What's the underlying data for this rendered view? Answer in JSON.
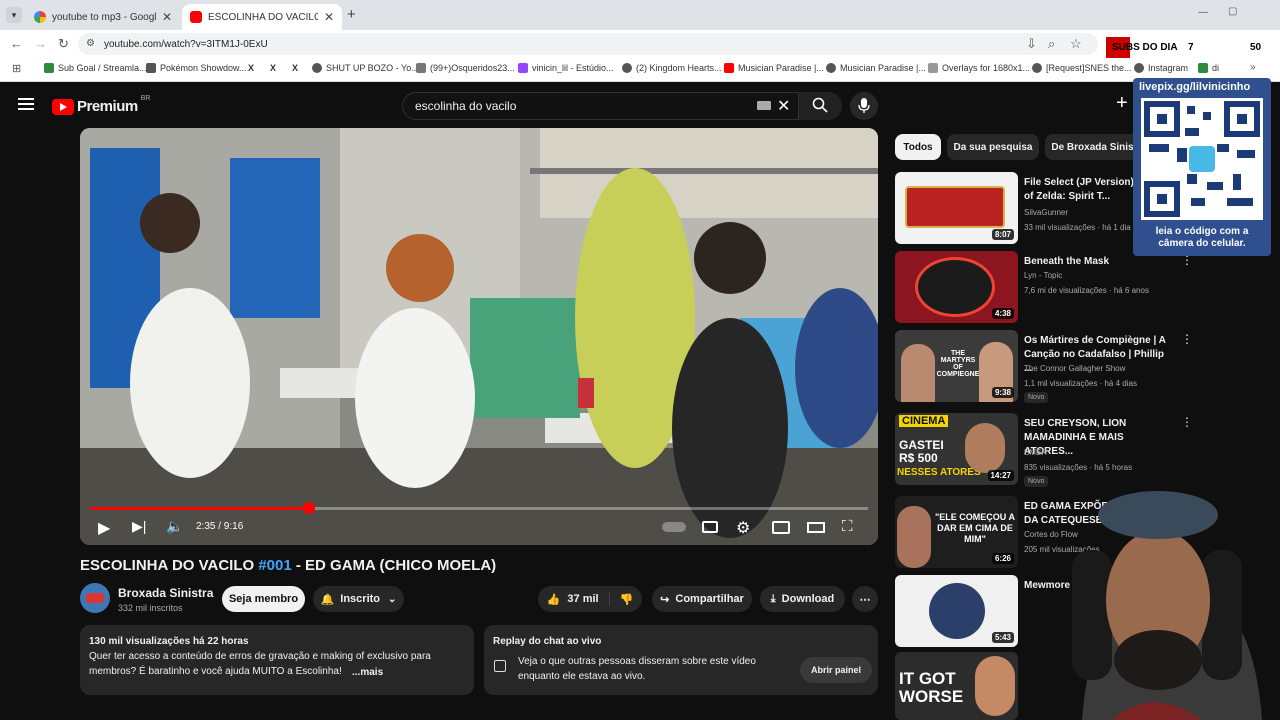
{
  "browser": {
    "tabs": [
      {
        "label": "youtube to mp3 - Google Sear",
        "active": false,
        "icon": "google-icon"
      },
      {
        "label": "ESCOLINHA DO VACILO #001 -",
        "active": true,
        "icon": "youtube-icon"
      }
    ],
    "url": "youtube.com/watch?v=3ITM1J-0ExU",
    "bookmarks": [
      "Sub Goal / Streamla...",
      "Pokémon Showdow...",
      "X",
      "X",
      "SHUT UP BOZO - Yo...",
      "(99+)Osqueridos23...",
      "vinicin_lil - Estúdio...",
      "(2) Kingdom Hearts...",
      "Musician Paradise |...",
      "Musician Paradise |...",
      "Overlays for 1680x1...",
      "[Request]SNES the...",
      "Instagram",
      "di"
    ]
  },
  "overlay": {
    "subs_label": "SUBS DO DIA",
    "subs_count": "7",
    "subs_goal": "50",
    "qr_url": "livepix.gg/lilvinicinho",
    "qr_caption": "leia o código com a câmera do celular."
  },
  "header": {
    "logo": "Premium",
    "region": "BR",
    "search_value": "escolinha do vacilo"
  },
  "player": {
    "time": "2:35 / 9:16",
    "progress": 0.282
  },
  "video": {
    "title_prefix": "ESCOLINHA DO VACILO ",
    "title_hash": "#001",
    "title_suffix": " - ED GAMA (CHICO MOELA)",
    "channel": "Broxada Sinistra",
    "subscribers": "332 mil inscritos",
    "join_label": "Seja membro",
    "subscribed_label": "Inscrito",
    "likes": "37 mil",
    "share_label": "Compartilhar",
    "download_label": "Download"
  },
  "description": {
    "meta": "130 mil visualizações  há 22 horas",
    "text": "Quer ter acesso a conteúdo de erros de gravação e making of exclusivo para membros? É baratinho e você ajuda MUITO a Escolinha!",
    "more": "...mais"
  },
  "chat_replay": {
    "title": "Replay do chat ao vivo",
    "text": "Veja o que outras pessoas disseram sobre este vídeo enquanto ele estava ao vivo.",
    "button": "Abrir painel"
  },
  "sidebar": {
    "chips": [
      "Todos",
      "Da sua pesquisa",
      "De Broxada Sinis"
    ],
    "recs": [
      {
        "title": "File Select (JP Version) Legend of Zelda: Spirit T...",
        "channel": "SilvaGunner",
        "meta": "33 mil visualizações · há 1 dia",
        "duration": "8:07",
        "badge": ""
      },
      {
        "title": "Beneath the Mask",
        "channel": "Lyn - Topic",
        "meta": "7,6 mi de visualizações · há 6 anos",
        "duration": "4:38",
        "badge": ""
      },
      {
        "title": "Os Mártires de Compiègne | A Canção no Cadafalso | Phillip ...",
        "channel": "The Connor Gallagher Show",
        "meta": "1,1 mil visualizações · há 4 dias",
        "duration": "9:38",
        "badge": "Novo"
      },
      {
        "title": "SEU CREYSON, LION MAMADINHA E MAIS ATORES...",
        "channel": "BMBR",
        "meta": "835 visualizações · há 5 horas",
        "duration": "14:27",
        "badge": "Novo"
      },
      {
        "title": "ED GAMA EXPÕE BASTIDOR DA CATEQUESE...",
        "channel": "Cortes do Flow",
        "meta": "205 mil visualizações",
        "duration": "6:26",
        "badge": ""
      },
      {
        "title": "Mewmore (Pokémon)",
        "channel": "",
        "meta": "",
        "duration": "5:43",
        "badge": ""
      }
    ],
    "rec3_thumb_text": "THE MARTYRS OF COMPIEGNE",
    "rec4_thumb_top": "CINEMA",
    "rec4_thumb_mid": "GASTEI R$ 500",
    "rec4_thumb_bot": "NESSES ATORES",
    "rec5_thumb_text": "\"ELE COMEÇOU A DAR EM CIMA DE MIM\"",
    "rec7_thumb_text": "IT GOT WORSE"
  },
  "colors": {
    "accent": "#ff0000",
    "link": "#3ea6ff",
    "bg": "#0f0f0f"
  }
}
